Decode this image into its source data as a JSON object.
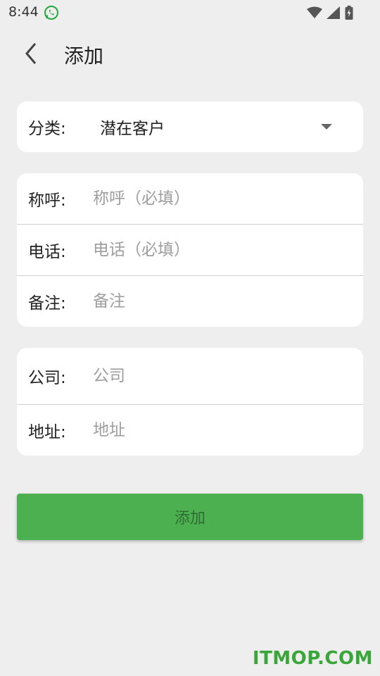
{
  "status_bar": {
    "time": "8:44",
    "icons": [
      "whatsapp-icon",
      "wifi-icon",
      "cellular-signal-icon",
      "battery-icon"
    ]
  },
  "header": {
    "title": "添加",
    "back_icon": "chevron-left-icon"
  },
  "category": {
    "label": "分类:",
    "value": "潜在客户",
    "dropdown_icon": "caret-down-icon"
  },
  "contact": {
    "name": {
      "label": "称呼:",
      "placeholder": "称呼（必填）",
      "value": ""
    },
    "phone": {
      "label": "电话:",
      "placeholder": "电话（必填）",
      "value": ""
    },
    "note": {
      "label": "备注:",
      "placeholder": "备注",
      "value": ""
    }
  },
  "company_info": {
    "company": {
      "label": "公司:",
      "placeholder": "公司",
      "value": ""
    },
    "address": {
      "label": "地址:",
      "placeholder": "地址",
      "value": ""
    }
  },
  "submit": {
    "label": "添加"
  },
  "watermark": {
    "text": "ITMOP.COM"
  },
  "colors": {
    "background": "#eeeeee",
    "card": "#ffffff",
    "accent": "#4caf50",
    "placeholder": "#9e9e9e",
    "watermark": "#3aa63a"
  }
}
